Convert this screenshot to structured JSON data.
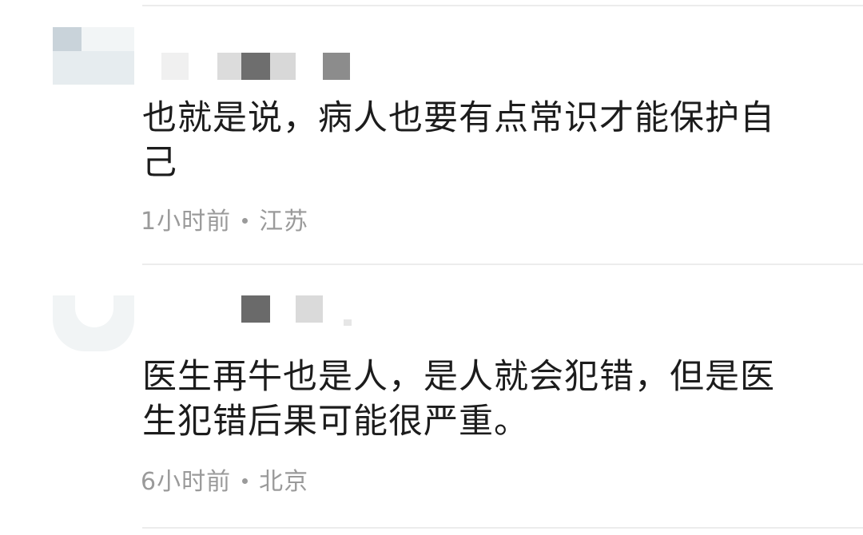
{
  "comments": [
    {
      "text": "也就是说，病人也要有点常识才能保护自己",
      "time": "1小时前",
      "location": "江苏"
    },
    {
      "text": "医生再牛也是人，是人就会犯错，但是医生犯错后果可能很严重。",
      "time": "6小时前",
      "location": "北京"
    }
  ]
}
